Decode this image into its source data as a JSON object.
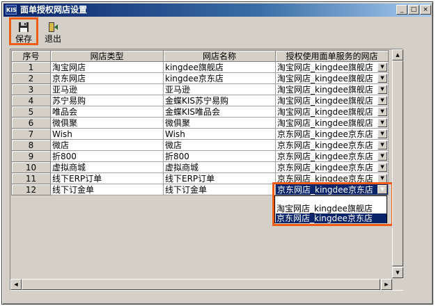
{
  "window": {
    "app_icon_text": "KIS",
    "title": "面单授权网店设置",
    "controls": {
      "minimize": "_",
      "maximize": "□",
      "close": "×"
    }
  },
  "toolbar": {
    "save_label": "保存",
    "exit_label": "退出",
    "save_icon": "floppy-disk-icon",
    "exit_icon": "door-exit-icon"
  },
  "grid": {
    "columns": [
      "序号",
      "网店类型",
      "网店名称",
      "授权使用面单服务的网店"
    ],
    "rows": [
      {
        "no": "1",
        "type": "淘宝网店",
        "name": "kingdee旗舰店",
        "auth": "淘宝网店_kingdee旗舰店"
      },
      {
        "no": "2",
        "type": "京东网店",
        "name": "kingdee京东店",
        "auth": "淘宝网店_kingdee旗舰店"
      },
      {
        "no": "3",
        "type": "亚马逊",
        "name": "亚马逊",
        "auth": "淘宝网店_kingdee旗舰店"
      },
      {
        "no": "4",
        "type": "苏宁易购",
        "name": "金蝶KIS苏宁易购",
        "auth": "淘宝网店_kingdee旗舰店"
      },
      {
        "no": "5",
        "type": "唯品会",
        "name": "金蝶KIS唯品会",
        "auth": "淘宝网店_kingdee旗舰店"
      },
      {
        "no": "6",
        "type": "微俱聚",
        "name": "微俱聚",
        "auth": "淘宝网店_kingdee旗舰店"
      },
      {
        "no": "7",
        "type": "Wish",
        "name": "Wish",
        "auth": "京东网店_kingdee京东店"
      },
      {
        "no": "8",
        "type": "微店",
        "name": "微店",
        "auth": "京东网店_kingdee京东店"
      },
      {
        "no": "9",
        "type": "折800",
        "name": "折800",
        "auth": "京东网店_kingdee京东店"
      },
      {
        "no": "10",
        "type": "虚拟商城",
        "name": "虚拟商城",
        "auth": "京东网店_kingdee京东店"
      },
      {
        "no": "11",
        "type": "线下ERP订单",
        "name": "线下ERP订单",
        "auth": "京东网店_kingdee京东店"
      },
      {
        "no": "12",
        "type": "线下订金单",
        "name": "线下订金单",
        "auth": "京东网店_kingdee京东店"
      }
    ]
  },
  "dropdown": {
    "options": [
      "",
      "淘宝网店_kingdee旗舰店",
      "京东网店_kingdee京东店"
    ],
    "selected_index": 2
  },
  "colors": {
    "highlight_border": "#f05a14",
    "selection": "#0a246a"
  }
}
